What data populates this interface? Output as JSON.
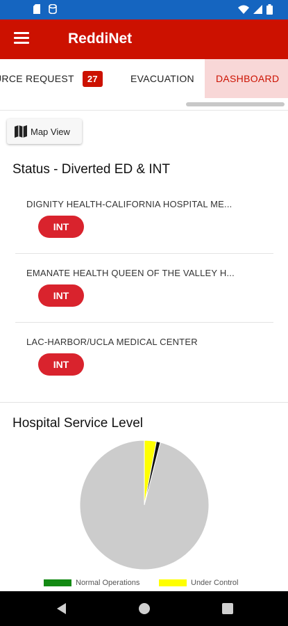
{
  "app": {
    "title": "ReddiNet",
    "colors": {
      "brand": "#cc1100",
      "status_bar": "#1565c0",
      "int_button": "#d9232d"
    }
  },
  "tabs": [
    {
      "label": "URCE REQUEST",
      "badge": "27"
    },
    {
      "label": "EVACUATION"
    },
    {
      "label": "DASHBOARD",
      "active": true
    }
  ],
  "map_button": {
    "label": "Map View",
    "icon": "map-icon"
  },
  "diverted": {
    "title": "Status - Diverted ED & INT",
    "hospitals": [
      {
        "name": "DIGNITY HEALTH-CALIFORNIA HOSPITAL ME...",
        "status": "INT"
      },
      {
        "name": "EMANATE HEALTH QUEEN OF THE VALLEY H...",
        "status": "INT"
      },
      {
        "name": "LAC-HARBOR/UCLA MEDICAL CENTER",
        "status": "INT"
      }
    ]
  },
  "service_level": {
    "title": "Hospital Service Level"
  },
  "chart_data": {
    "type": "pie",
    "title": "Hospital Service Level",
    "slices": [
      {
        "label": "Normal Operations",
        "value": 96,
        "color": "#cccccc"
      },
      {
        "label": "Under Control",
        "value": 3,
        "color": "#ffff00"
      },
      {
        "label": "",
        "value": 1,
        "color": "#111111"
      }
    ],
    "legend": [
      {
        "label": "Normal Operations",
        "color": "#138a13"
      },
      {
        "label": "Under Control",
        "color": "#ffff00"
      }
    ],
    "legend_position": "bottom"
  }
}
